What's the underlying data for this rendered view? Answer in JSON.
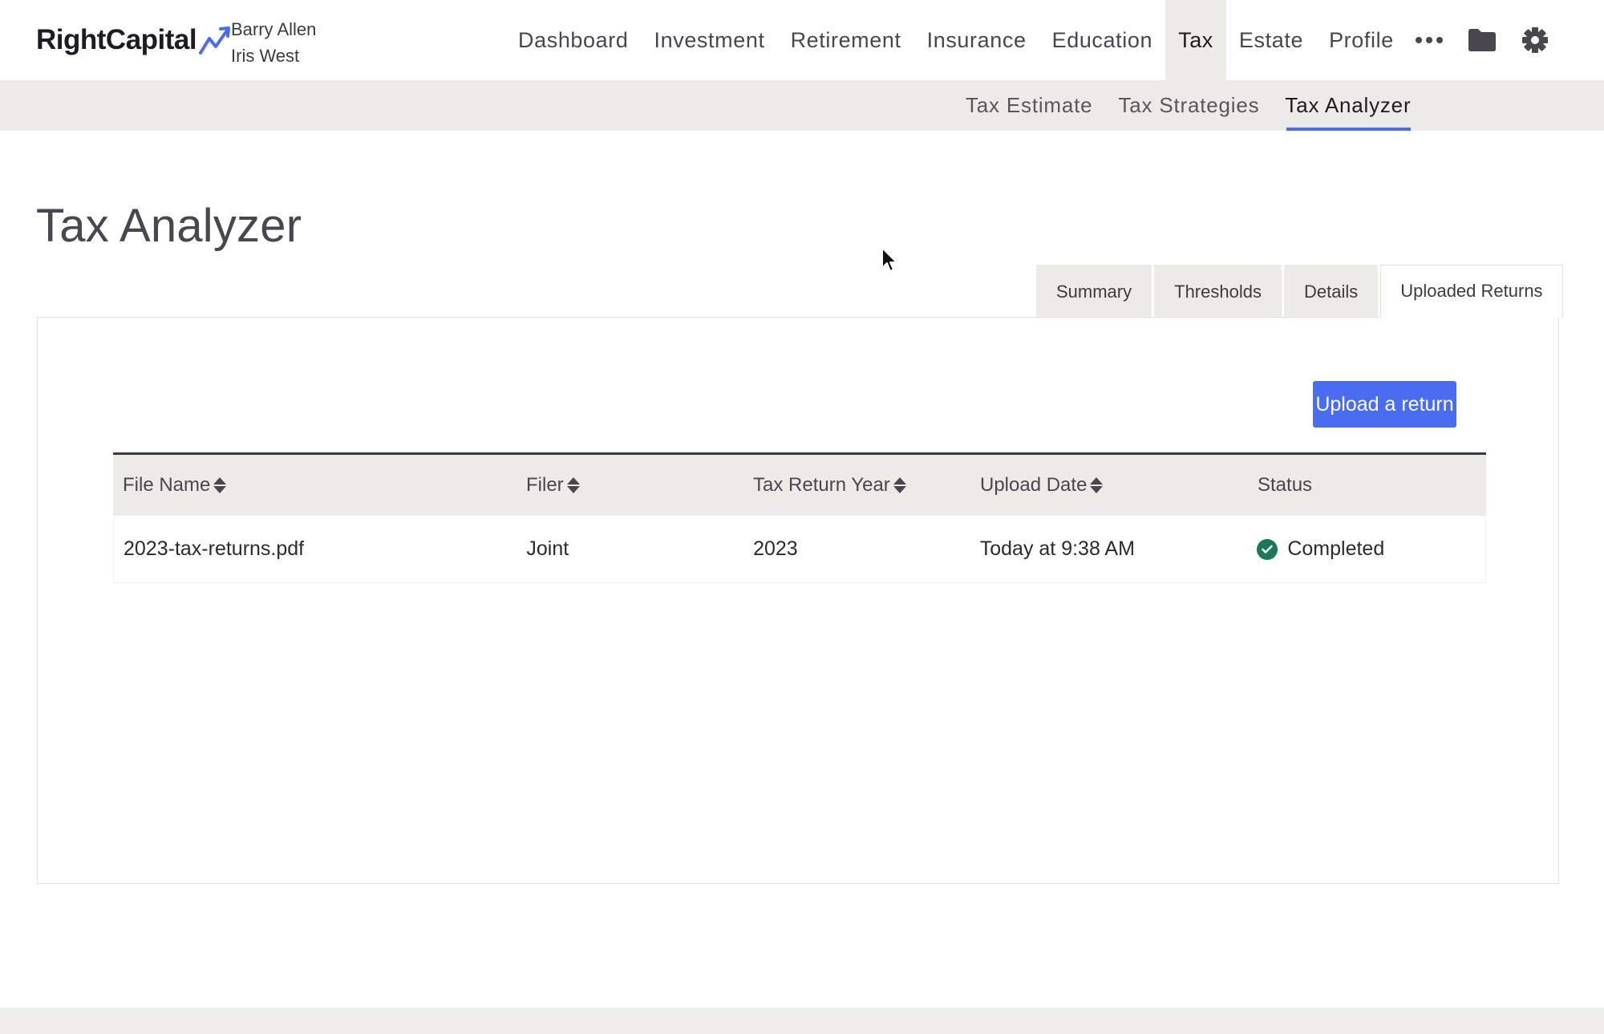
{
  "brand": {
    "name": "RightCapital",
    "accent": "#4a6cf0"
  },
  "clients": [
    "Barry Allen",
    "Iris West"
  ],
  "main_nav": [
    {
      "label": "Dashboard",
      "active": false
    },
    {
      "label": "Investment",
      "active": false
    },
    {
      "label": "Retirement",
      "active": false
    },
    {
      "label": "Insurance",
      "active": false
    },
    {
      "label": "Education",
      "active": false
    },
    {
      "label": "Tax",
      "active": true
    },
    {
      "label": "Estate",
      "active": false
    },
    {
      "label": "Profile",
      "active": false
    }
  ],
  "nav_icons": [
    "more-icon",
    "folder-icon",
    "gear-icon"
  ],
  "sub_nav": [
    {
      "label": "Tax Estimate",
      "active": false
    },
    {
      "label": "Tax Strategies",
      "active": false
    },
    {
      "label": "Tax Analyzer",
      "active": true
    }
  ],
  "page": {
    "title": "Tax Analyzer"
  },
  "tabs": [
    {
      "label": "Summary",
      "active": false
    },
    {
      "label": "Thresholds",
      "active": false
    },
    {
      "label": "Details",
      "active": false
    },
    {
      "label": "Uploaded Returns",
      "active": true
    }
  ],
  "upload_button": {
    "label": "Upload a return"
  },
  "table": {
    "headers": [
      {
        "label": "File Name",
        "sortable": true
      },
      {
        "label": "Filer",
        "sortable": true
      },
      {
        "label": "Tax Return Year",
        "sortable": true
      },
      {
        "label": "Upload Date",
        "sortable": true
      },
      {
        "label": "Status",
        "sortable": false
      }
    ],
    "rows": [
      {
        "file_name": "2023-tax-returns.pdf",
        "filer": "Joint",
        "year": "2023",
        "upload_date": "Today at 9:38 AM",
        "status": "Completed",
        "status_color": "#1b7a55"
      }
    ]
  }
}
